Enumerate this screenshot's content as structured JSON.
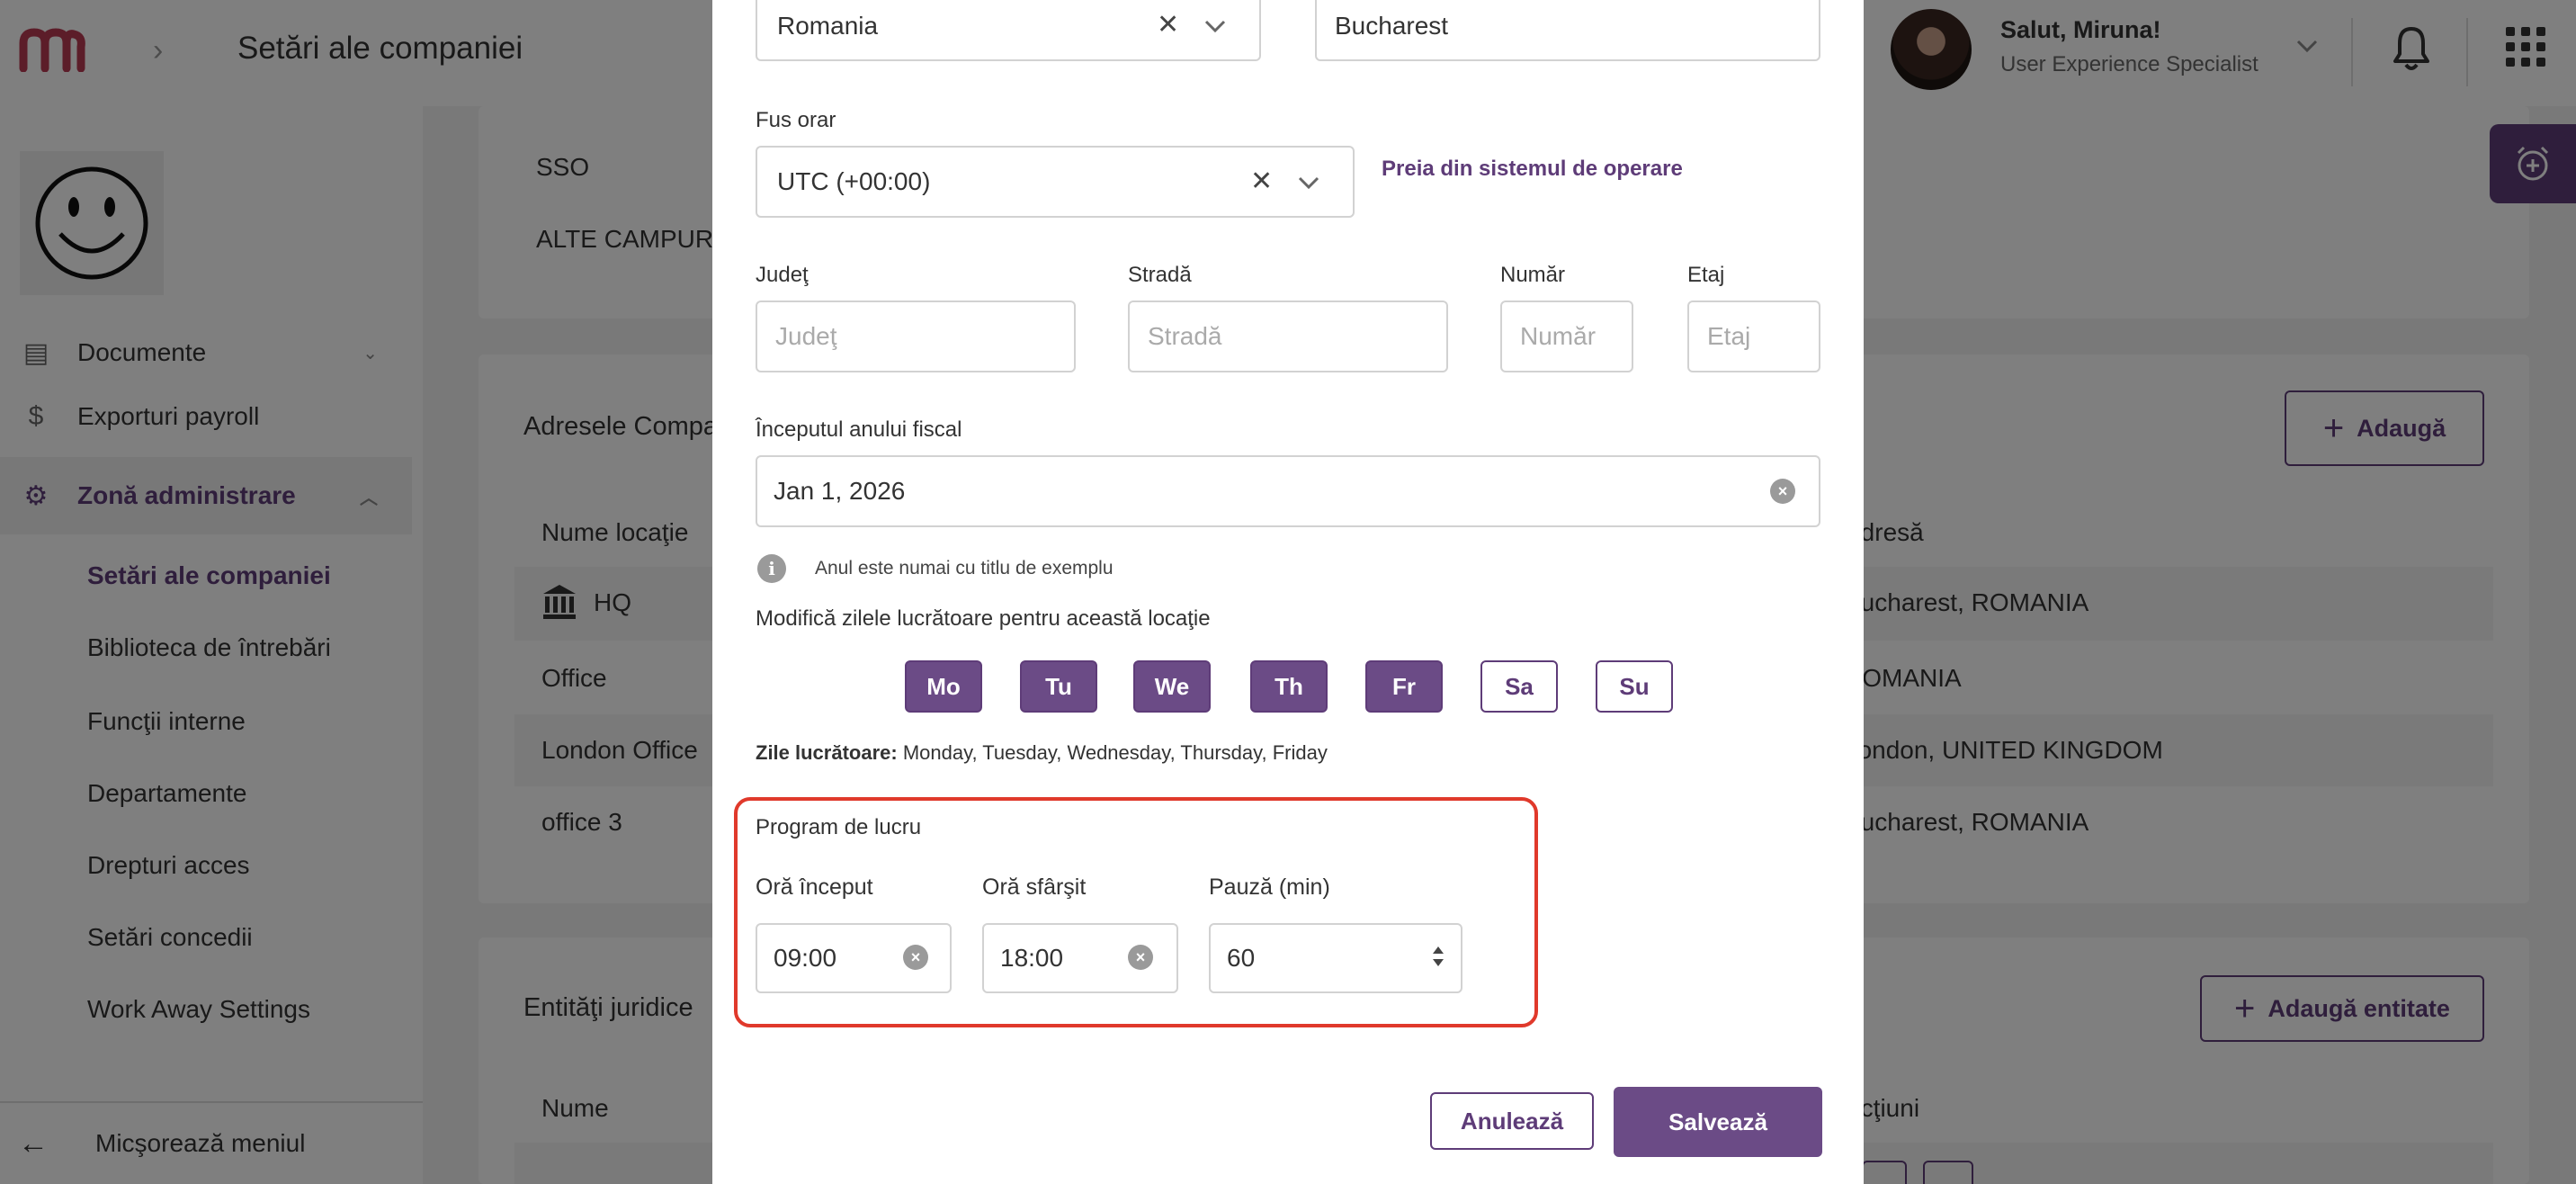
{
  "header": {
    "page_title": "Setări ale companiei",
    "greeting": "Salut, Miruna!",
    "role": "User Experience Specialist"
  },
  "sidebar": {
    "items": [
      {
        "label": "Documente",
        "icon": "document-icon"
      },
      {
        "label": "Exporturi payroll",
        "icon": "dollar-icon"
      },
      {
        "label": "Zonă administrare",
        "icon": "gear-icon"
      }
    ],
    "sub_items": [
      "Setări ale companiei",
      "Biblioteca de întrebări",
      "Funcţii interne",
      "Departamente",
      "Drepturi acces",
      "Setări concedii",
      "Work Away Settings"
    ],
    "collapse_label": "Micşorează meniul"
  },
  "background": {
    "sso_label": "SSO",
    "other_fields_label": "ALTE CAMPURI",
    "addresses_title": "Adresele Compa",
    "add_label": "Adaugă",
    "col_location": "Nume locaţie",
    "col_address": "Adresă",
    "rows": [
      {
        "name": "HQ",
        "address": "Bucharest, ROMANIA"
      },
      {
        "name": "Office",
        "address": "ROMANIA"
      },
      {
        "name": "London Office",
        "address": "London, UNITED KINGDOM"
      },
      {
        "name": "office 3",
        "address": "Bucharest, ROMANIA"
      }
    ],
    "legal_title": "Entităţi juridice",
    "add_entity_label": "Adaugă entitate",
    "col_name": "Nume",
    "col_actions": "Acţiuni"
  },
  "modal": {
    "country_value": "Romania",
    "city_value": "Bucharest",
    "timezone_label": "Fus orar",
    "timezone_value": "UTC (+00:00)",
    "timezone_link": "Preia din sistemul de operare",
    "county_label": "Judeţ",
    "county_placeholder": "Judeţ",
    "street_label": "Stradă",
    "street_placeholder": "Stradă",
    "number_label": "Număr",
    "number_placeholder": "Număr",
    "floor_label": "Etaj",
    "floor_placeholder": "Etaj",
    "fiscal_label": "Începutul anului fiscal",
    "fiscal_value": "Jan 1, 2026",
    "fiscal_hint": "Anul este numai cu titlu de exemplu",
    "workdays_label": "Modifică zilele lucrătoare pentru această locaţie",
    "days": [
      {
        "label": "Mo",
        "active": true
      },
      {
        "label": "Tu",
        "active": true
      },
      {
        "label": "We",
        "active": true
      },
      {
        "label": "Th",
        "active": true
      },
      {
        "label": "Fr",
        "active": true
      },
      {
        "label": "Sa",
        "active": false
      },
      {
        "label": "Su",
        "active": false
      }
    ],
    "workdays_summary_label": "Zile lucrătoare:",
    "workdays_summary_value": "Monday, Tuesday, Wednesday, Thursday, Friday",
    "schedule_title": "Program de lucru",
    "start_label": "Oră început",
    "start_value": "09:00",
    "end_label": "Oră sfârşit",
    "end_value": "18:00",
    "break_label": "Pauză (min)",
    "break_value": "60",
    "cancel_label": "Anulează",
    "save_label": "Salvează"
  },
  "colors": {
    "brand": "#5e3c78",
    "brand_fill": "#6b4b86",
    "highlight": "#e0392b",
    "logo": "#b83a52"
  }
}
